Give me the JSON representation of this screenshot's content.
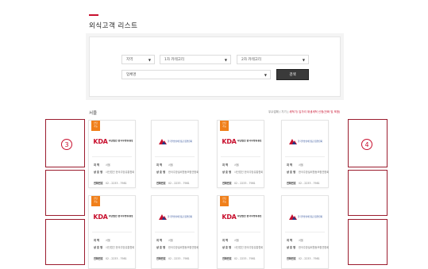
{
  "page": {
    "title": "외식고객 리스트"
  },
  "filters": {
    "region": {
      "value": "지역"
    },
    "category1": {
      "value": "1차 카테고리"
    },
    "category2": {
      "value": "2차 카테고리"
    },
    "search": {
      "placeholder": "업체명"
    },
    "search_button": "검색"
  },
  "list": {
    "section_label": "서울",
    "legend_prefix": "우수업체 / 기기",
    "legend_highlight": "세척기/ 입가리 위생세척 신청(전화 및 포함)"
  },
  "cards": [
    {
      "ribbon": "전담\n가능",
      "logo": "kda",
      "logo_text": "KDA",
      "org_text": "사단법인 한국주방유통협회",
      "label_area": "지 역",
      "area": "서울",
      "label_name": "상 호 명",
      "name": "사단법인 한국주방유통협회",
      "label_phone": "전화번호",
      "phone": "02 - 2233 - 7981"
    },
    {
      "ribbon": "",
      "logo": "assoc",
      "org_text": "한국주방설비협동조합연합회",
      "label_area": "지 역",
      "area": "서울",
      "label_name": "상 호 명",
      "name": "한국주방설비협동조합연합회",
      "label_phone": "전화번호",
      "phone": "02 - 2233 - 7981"
    },
    {
      "ribbon": "전담\n가능",
      "logo": "kda",
      "logo_text": "KDA",
      "org_text": "사단법인 한국주방유통협회",
      "label_area": "지 역",
      "area": "서울",
      "label_name": "상 호 명",
      "name": "사단법인 한국주방유통협회",
      "label_phone": "전화번호",
      "phone": "02 - 2233 - 7981"
    },
    {
      "ribbon": "",
      "logo": "assoc",
      "org_text": "한국주방설비협동조합연합회",
      "label_area": "지 역",
      "area": "서울",
      "label_name": "상 호 명",
      "name": "한국주방설비협동조합연합회",
      "label_phone": "전화번호",
      "phone": "02 - 2233 - 7981"
    },
    {
      "ribbon": "전담\n가능",
      "logo": "kda",
      "logo_text": "KDA",
      "org_text": "사단법인 한국주방유통협회",
      "label_area": "지 역",
      "area": "서울",
      "label_name": "상 호 명",
      "name": "사단법인 한국주방유통협회",
      "label_phone": "전화번호",
      "phone": "02 - 2233 - 7981"
    },
    {
      "ribbon": "",
      "logo": "assoc",
      "org_text": "한국주방설비협동조합연합회",
      "label_area": "지 역",
      "area": "서울",
      "label_name": "상 호 명",
      "name": "한국주방설비협동조합연합회",
      "label_phone": "전화번호",
      "phone": "02 - 2233 - 7981"
    },
    {
      "ribbon": "전담\n가능",
      "logo": "kda",
      "logo_text": "KDA",
      "org_text": "사단법인 한국주방유통협회",
      "label_area": "지 역",
      "area": "서울",
      "label_name": "상 호 명",
      "name": "사단법인 한국주방유통협회",
      "label_phone": "전화번호",
      "phone": "02 - 2233 - 7981"
    },
    {
      "ribbon": "",
      "logo": "assoc",
      "org_text": "한국주방설비협동조합연합회",
      "label_area": "지 역",
      "area": "서울",
      "label_name": "상 호 명",
      "name": "한국주방설비협동조합연합회",
      "label_phone": "전화번호",
      "phone": "02 - 2233 - 7981"
    }
  ],
  "annotations": {
    "left_number": "3",
    "right_number": "4",
    "color": "#c8102e",
    "box_color": "#9b1c2e"
  },
  "colors": {
    "accent": "#c8102e",
    "ribbon": "#f07f1a",
    "button": "#3a3a3a"
  }
}
